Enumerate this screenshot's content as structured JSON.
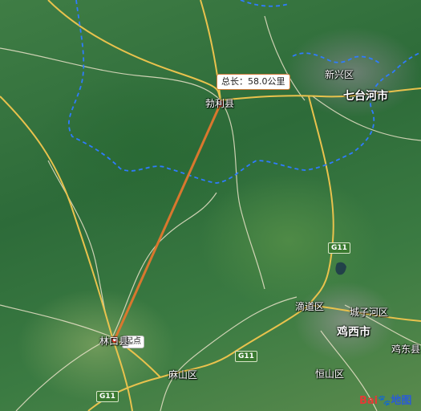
{
  "map": {
    "type": "satellite",
    "brand": {
      "part1": "Bai",
      "part2": "地图",
      "paw_icon": "paw-icon"
    },
    "distance_tooltip": {
      "text": "总长：58.0公里"
    },
    "start_tooltip": {
      "text": "起点"
    },
    "route_color": "#d9772e",
    "boundary_color": "#2f7bff",
    "place_labels": {
      "boli": "勃利县",
      "linkou": "林口县",
      "xinxing": "新兴区",
      "qitaihe": "七台河市",
      "didao": "滴道区",
      "chengzihe": "城子河区",
      "jixi": "鸡西市",
      "jidong": "鸡东县",
      "mashan": "麻山区",
      "hengshan": "恒山区"
    },
    "road_shields": {
      "g11_east": "G11",
      "g11_center": "G11",
      "g11_south": "G11"
    }
  }
}
